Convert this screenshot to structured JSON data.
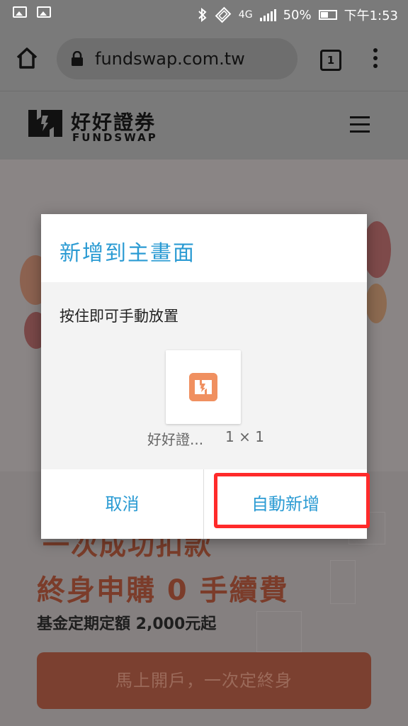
{
  "status_bar": {
    "battery": "50%",
    "time": "下午1:53",
    "network": "4G",
    "battery_level": 0.5,
    "icons": [
      "image-icon",
      "image-icon",
      "bluetooth-icon",
      "vibrate-icon",
      "signal-icon",
      "battery-icon"
    ]
  },
  "browser": {
    "url": "fundswap.com.tw",
    "tab_count": "1"
  },
  "site": {
    "brand_cn": "好好證券",
    "brand_en": "FUNDSWAP"
  },
  "page": {
    "headline_top": "一次成功扣款",
    "headline": "終身申購 0 手續費",
    "subline": "基金定期定額 2,000元起",
    "cta_label": "馬上開戶，一次定終身"
  },
  "dialog": {
    "title": "新增到主畫面",
    "instruction": "按住即可手動放置",
    "widget_label": "好好證...",
    "widget_size": "1 × 1",
    "cancel_label": "取消",
    "auto_add_label": "自動新增"
  },
  "colors": {
    "accent": "#2b9bd3",
    "highlight": "#ff2a2a",
    "app_icon": "#f09060"
  }
}
